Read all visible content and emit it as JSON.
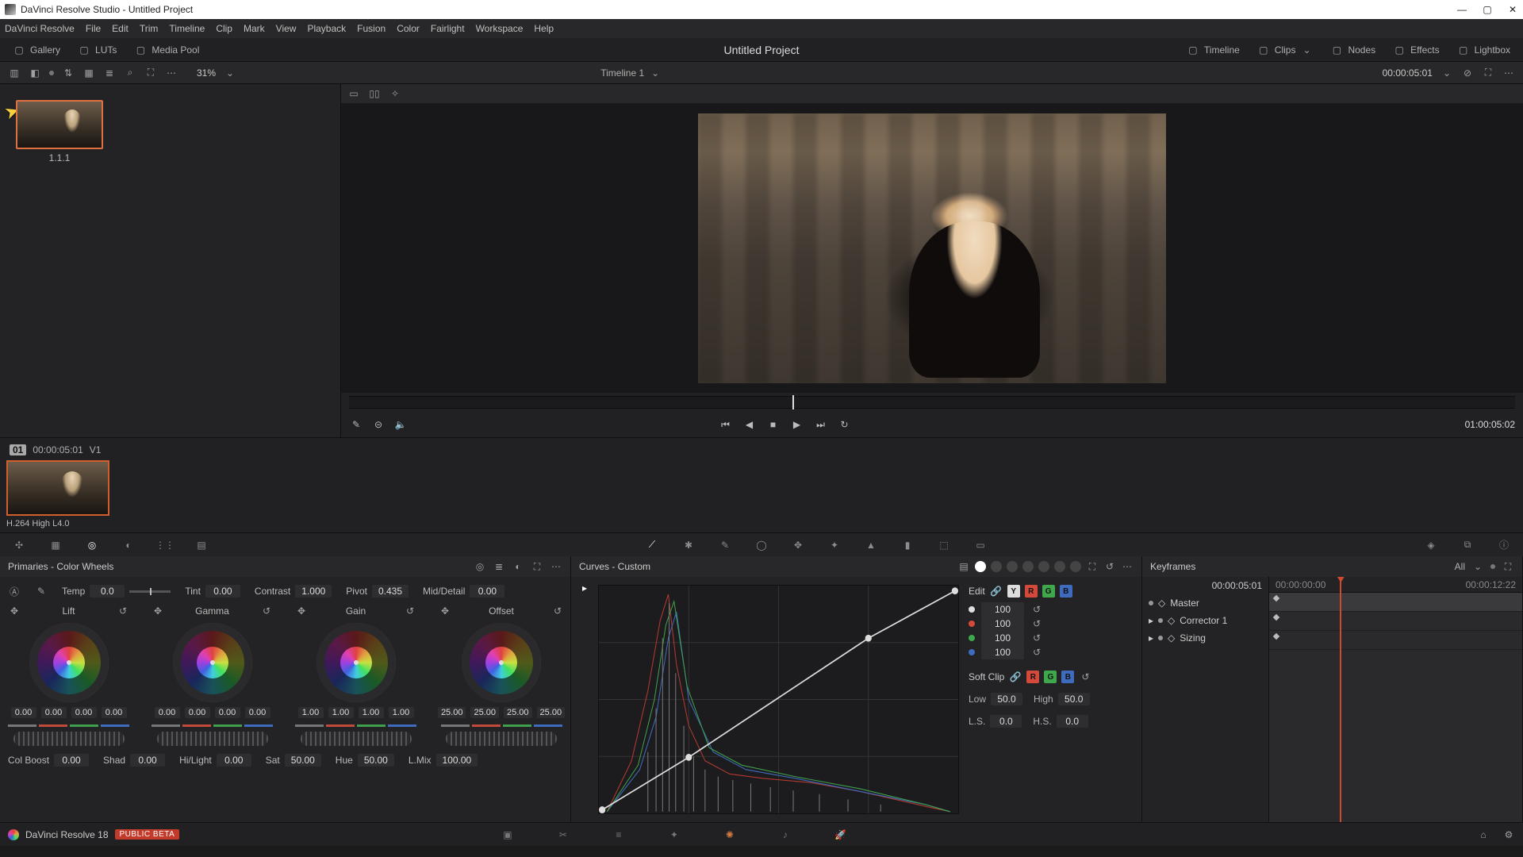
{
  "window": {
    "title": "DaVinci Resolve Studio - Untitled Project"
  },
  "menu": [
    "DaVinci Resolve",
    "File",
    "Edit",
    "Trim",
    "Timeline",
    "Clip",
    "Mark",
    "View",
    "Playback",
    "Fusion",
    "Color",
    "Fairlight",
    "Workspace",
    "Help"
  ],
  "toolbar": {
    "left": [
      {
        "icon": "gallery-icon",
        "label": "Gallery"
      },
      {
        "icon": "luts-icon",
        "label": "LUTs"
      },
      {
        "icon": "media-pool-icon",
        "label": "Media Pool"
      }
    ],
    "center": "Untitled Project",
    "right": [
      {
        "icon": "timeline-icon",
        "label": "Timeline"
      },
      {
        "icon": "clips-icon",
        "label": "Clips"
      },
      {
        "icon": "nodes-icon",
        "label": "Nodes"
      },
      {
        "icon": "effects-icon",
        "label": "Effects"
      },
      {
        "icon": "lightbox-icon",
        "label": "Lightbox"
      }
    ]
  },
  "subbar": {
    "zoom": "31%",
    "timeline_name": "Timeline 1",
    "timecode": "00:00:05:01"
  },
  "gallery": {
    "still_label": "1.1.1"
  },
  "transport": {
    "timecode": "01:00:05:02"
  },
  "clip": {
    "number": "01",
    "tc": "00:00:05:01",
    "track": "V1",
    "codec": "H.264 High L4.0"
  },
  "primaries": {
    "title": "Primaries - Color Wheels",
    "temp": {
      "label": "Temp",
      "value": "0.0"
    },
    "tint": {
      "label": "Tint",
      "value": "0.00"
    },
    "contrast": {
      "label": "Contrast",
      "value": "1.000"
    },
    "pivot": {
      "label": "Pivot",
      "value": "0.435"
    },
    "middetail": {
      "label": "Mid/Detail",
      "value": "0.00"
    },
    "wheels": {
      "lift": {
        "label": "Lift",
        "vals": [
          "0.00",
          "0.00",
          "0.00",
          "0.00"
        ]
      },
      "gamma": {
        "label": "Gamma",
        "vals": [
          "0.00",
          "0.00",
          "0.00",
          "0.00"
        ]
      },
      "gain": {
        "label": "Gain",
        "vals": [
          "1.00",
          "1.00",
          "1.00",
          "1.00"
        ]
      },
      "offset": {
        "label": "Offset",
        "vals": [
          "25.00",
          "25.00",
          "25.00",
          "25.00"
        ]
      }
    },
    "row2": {
      "colboost": {
        "label": "Col Boost",
        "value": "0.00"
      },
      "shad": {
        "label": "Shad",
        "value": "0.00"
      },
      "hilight": {
        "label": "Hi/Light",
        "value": "0.00"
      },
      "sat": {
        "label": "Sat",
        "value": "50.00"
      },
      "hue": {
        "label": "Hue",
        "value": "50.00"
      },
      "lmix": {
        "label": "L.Mix",
        "value": "100.00"
      }
    }
  },
  "curves": {
    "title": "Curves - Custom",
    "edit_label": "Edit",
    "channels": [
      {
        "color": "#dddddd",
        "value": "100"
      },
      {
        "color": "#d34a3b",
        "value": "100"
      },
      {
        "color": "#3fa84c",
        "value": "100"
      },
      {
        "color": "#3f6bbf",
        "value": "100"
      }
    ],
    "softclip": {
      "label": "Soft Clip"
    },
    "low": {
      "label": "Low",
      "value": "50.0"
    },
    "high": {
      "label": "High",
      "value": "50.0"
    },
    "ls": {
      "label": "L.S.",
      "value": "0.0"
    },
    "hs": {
      "label": "H.S.",
      "value": "0.0"
    }
  },
  "keyframes": {
    "title": "Keyframes",
    "all_label": "All",
    "tc": "00:00:05:01",
    "ruler_start": "00:00:00:00",
    "ruler_end": "00:00:12:22",
    "rows": [
      "Master",
      "Corrector 1",
      "Sizing"
    ]
  },
  "footer": {
    "brand": "DaVinci Resolve 18",
    "beta": "PUBLIC BETA"
  }
}
